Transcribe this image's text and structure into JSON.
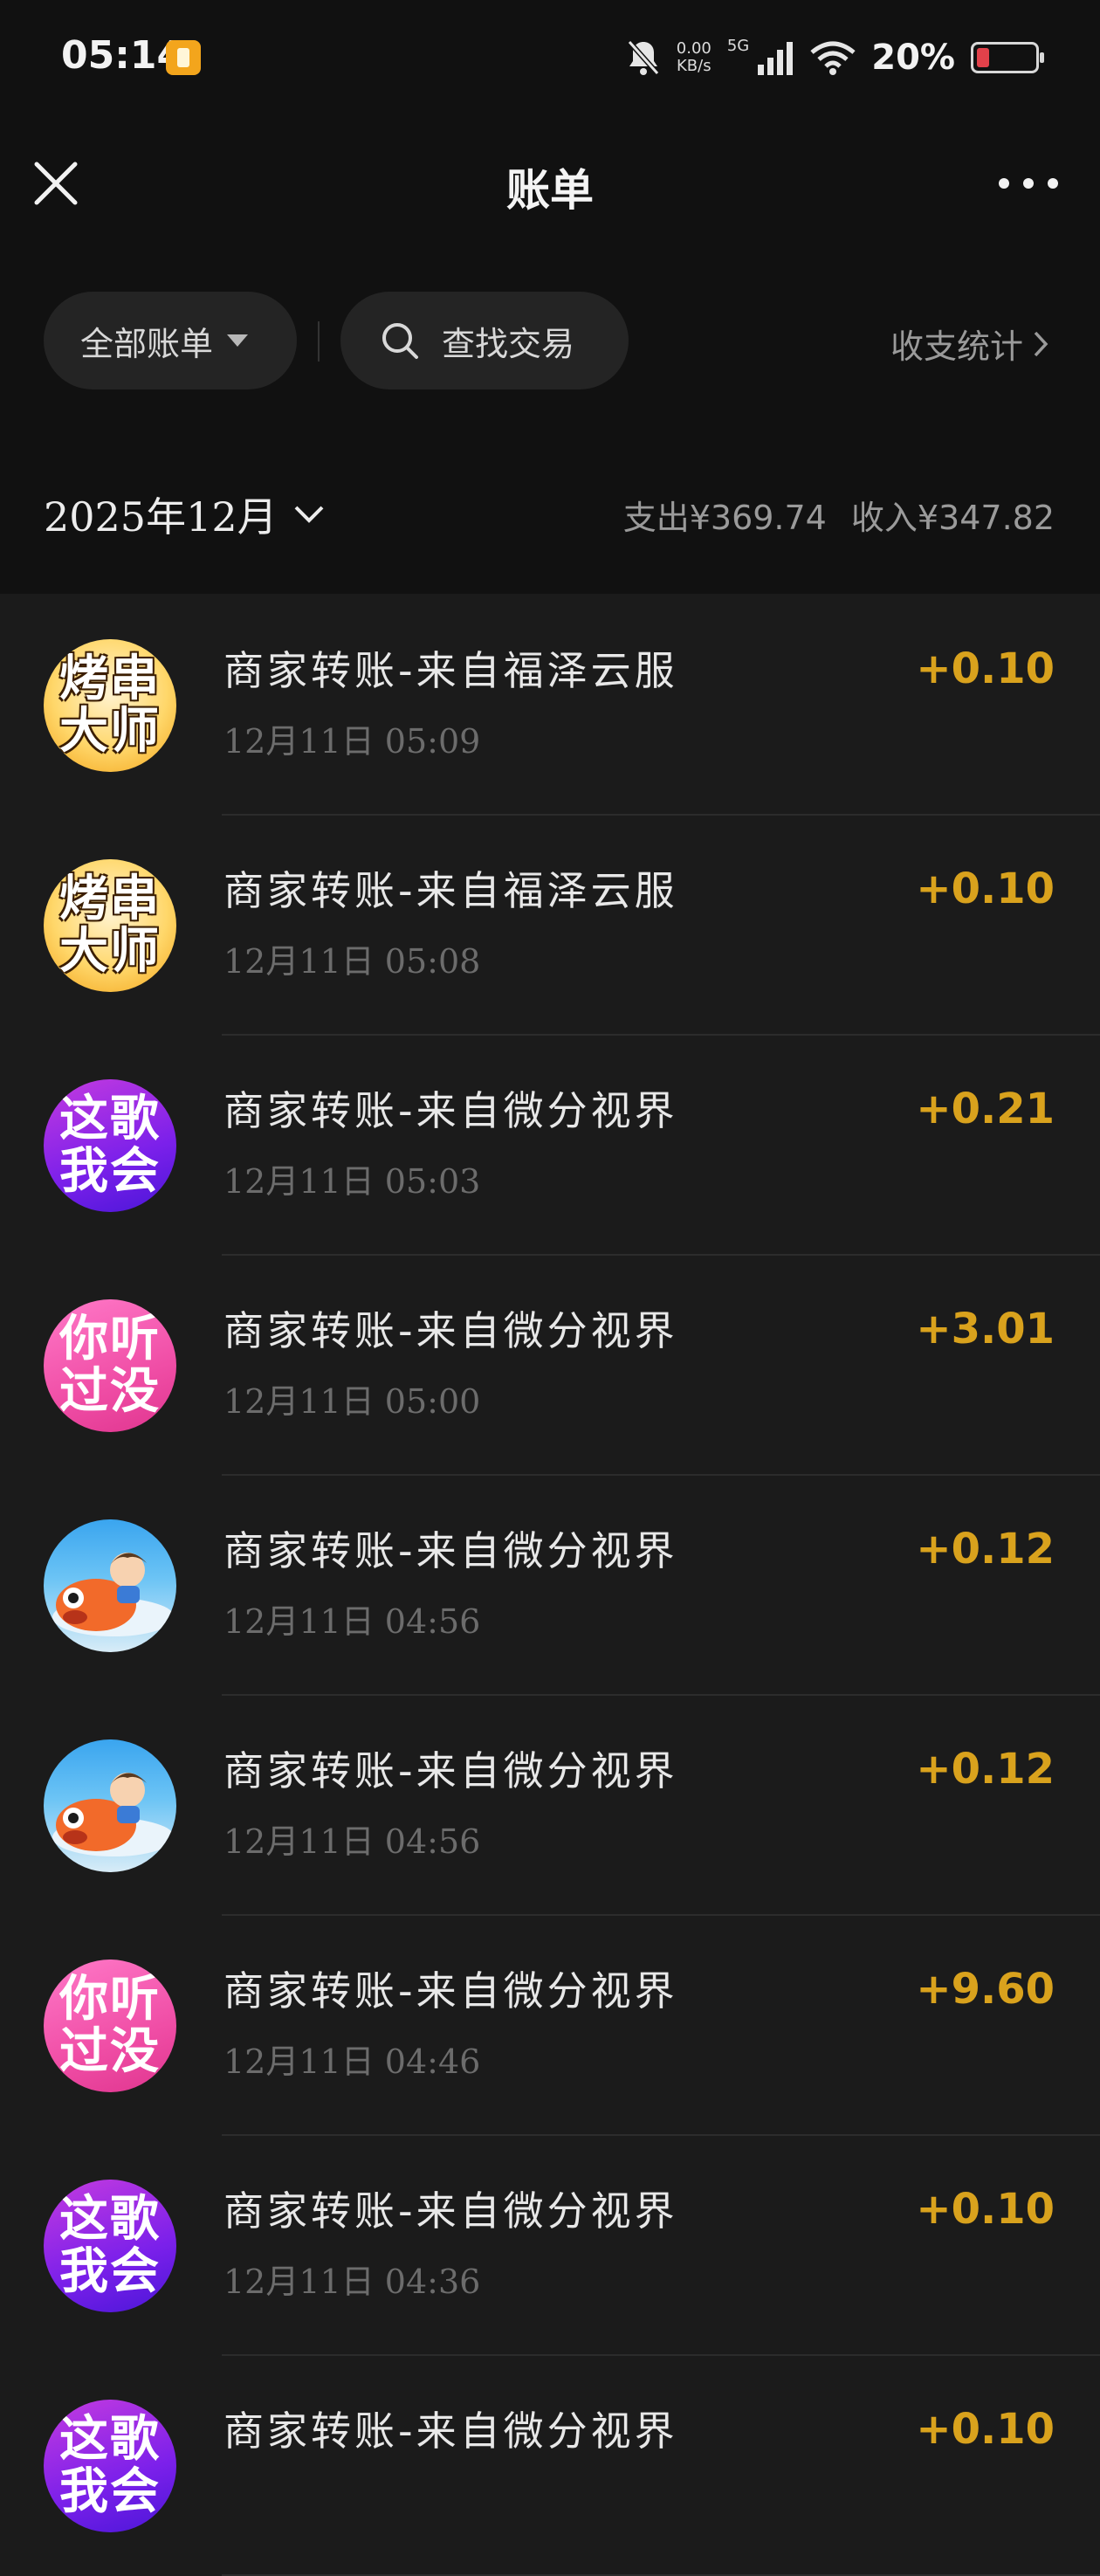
{
  "status_bar": {
    "time": "05:14",
    "net_speed_value": "0.00",
    "net_speed_unit": "KB/s",
    "network": "5G",
    "battery": "20%",
    "battery_level": 0.2
  },
  "header": {
    "title": "账单"
  },
  "filters": {
    "all_bills": "全部账单",
    "search": "查找交易",
    "stats": "收支统计"
  },
  "month_bar": {
    "month": "2025年12月",
    "expense": "支出¥369.74",
    "income": "收入¥347.82"
  },
  "transactions": [
    {
      "title": "商家转账-来自福泽云服",
      "time": "12月11日 05:09",
      "amount": "+0.10",
      "avatar": "烤串大师",
      "avatar_style": "kaochuan"
    },
    {
      "title": "商家转账-来自福泽云服",
      "time": "12月11日 05:08",
      "amount": "+0.10",
      "avatar": "烤串大师",
      "avatar_style": "kaochuan"
    },
    {
      "title": "商家转账-来自微分视界",
      "time": "12月11日 05:03",
      "amount": "+0.21",
      "avatar": "这歌我会",
      "avatar_style": "zhege"
    },
    {
      "title": "商家转账-来自微分视界",
      "time": "12月11日 05:00",
      "amount": "+3.01",
      "avatar": "你听过没",
      "avatar_style": "nitingguo"
    },
    {
      "title": "商家转账-来自微分视界",
      "time": "12月11日 04:56",
      "amount": "+0.12",
      "avatar": "",
      "avatar_style": "fish"
    },
    {
      "title": "商家转账-来自微分视界",
      "time": "12月11日 04:56",
      "amount": "+0.12",
      "avatar": "",
      "avatar_style": "fish"
    },
    {
      "title": "商家转账-来自微分视界",
      "time": "12月11日 04:46",
      "amount": "+9.60",
      "avatar": "你听过没",
      "avatar_style": "nitingguo"
    },
    {
      "title": "商家转账-来自微分视界",
      "time": "12月11日 04:36",
      "amount": "+0.10",
      "avatar": "这歌我会",
      "avatar_style": "zhege"
    },
    {
      "title": "商家转账-来自微分视界",
      "time": "",
      "amount": "+0.10",
      "avatar": "这歌我会",
      "avatar_style": "zhege"
    }
  ],
  "colors": {
    "background": "#1b1b1b",
    "bar_background": "#111111",
    "amount": "#d9a21d",
    "secondary_text": "#6c6c6c"
  }
}
